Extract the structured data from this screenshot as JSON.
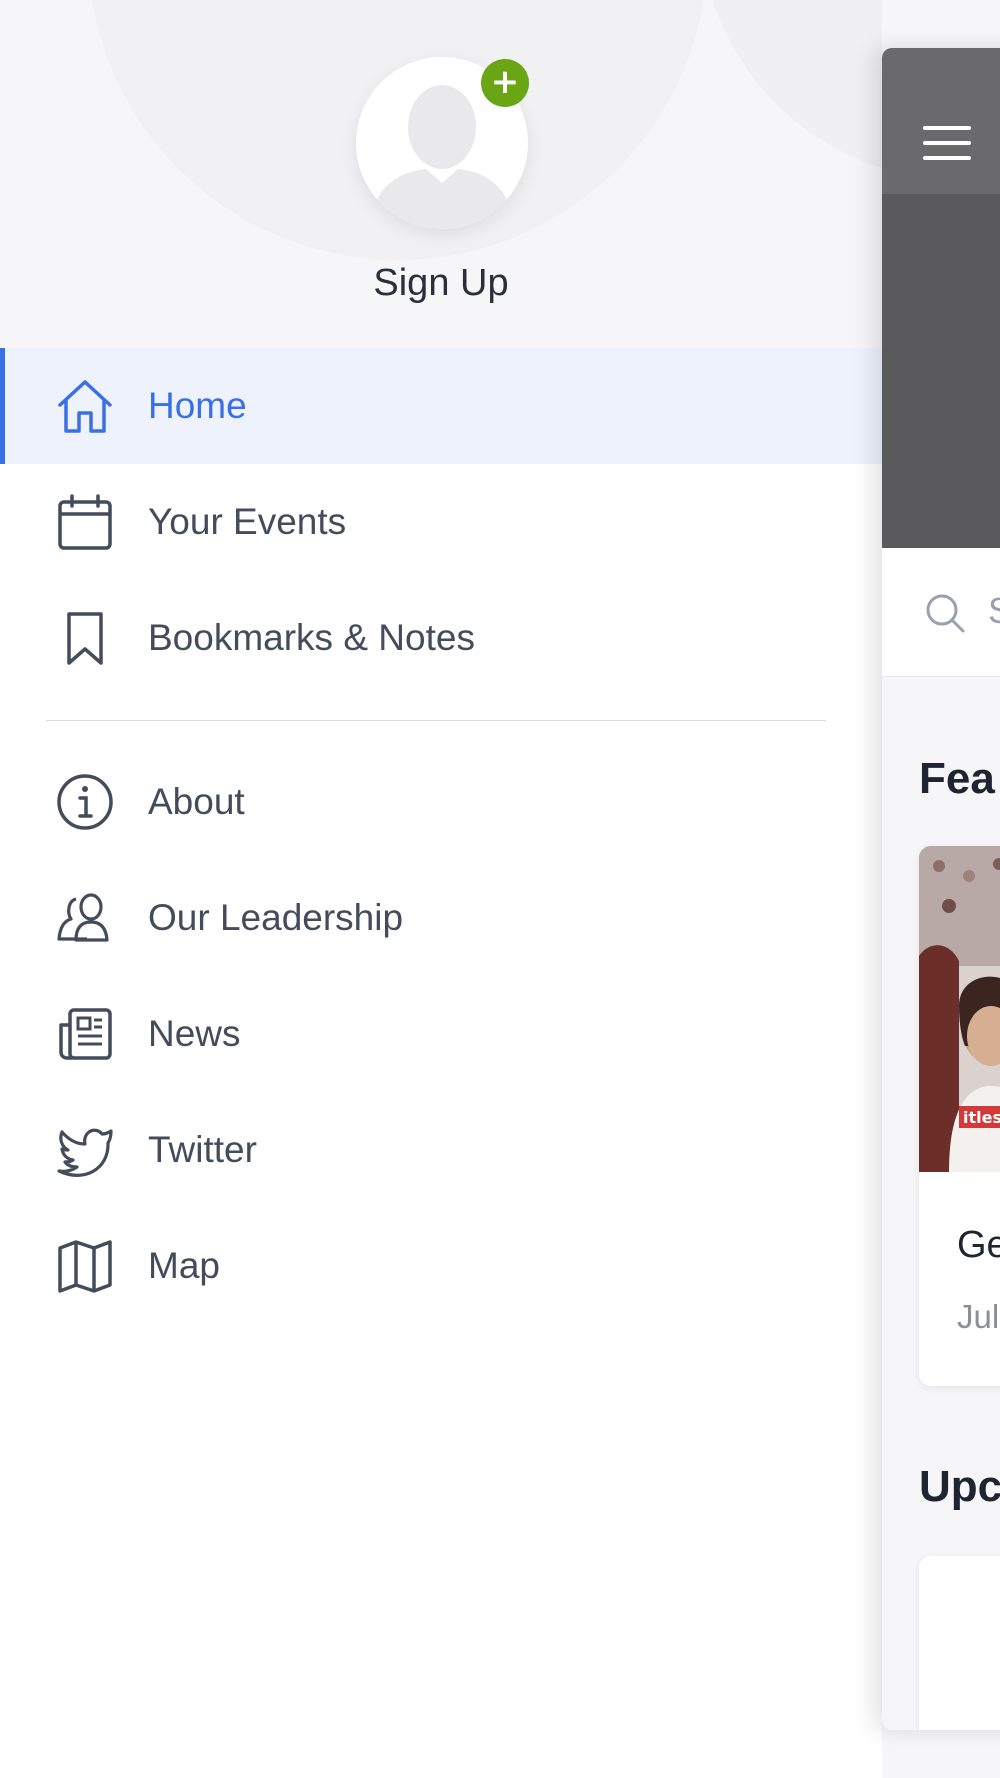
{
  "drawer": {
    "signup_label": "Sign Up",
    "avatar_add_label": "+",
    "items": [
      {
        "label": "Home",
        "icon": "home-icon",
        "active": true
      },
      {
        "label": "Your Events",
        "icon": "calendar-icon"
      },
      {
        "label": "Bookmarks & Notes",
        "icon": "bookmark-icon"
      },
      {
        "label": "About",
        "icon": "info-icon"
      },
      {
        "label": "Our Leadership",
        "icon": "people-icon"
      },
      {
        "label": "News",
        "icon": "newspaper-icon"
      },
      {
        "label": "Twitter",
        "icon": "twitter-icon"
      },
      {
        "label": "Map",
        "icon": "map-icon"
      }
    ]
  },
  "main": {
    "search_placeholder": "S",
    "featured_title": "Fea",
    "featured_card": {
      "title": "Ge",
      "date": "Jul",
      "image_text": "itless"
    },
    "upcoming_title": "Upc"
  },
  "colors": {
    "accent": "#3a70e3",
    "active_bg": "#eef2fd",
    "add_badge": "#6aa514",
    "text": "#444b5a"
  }
}
